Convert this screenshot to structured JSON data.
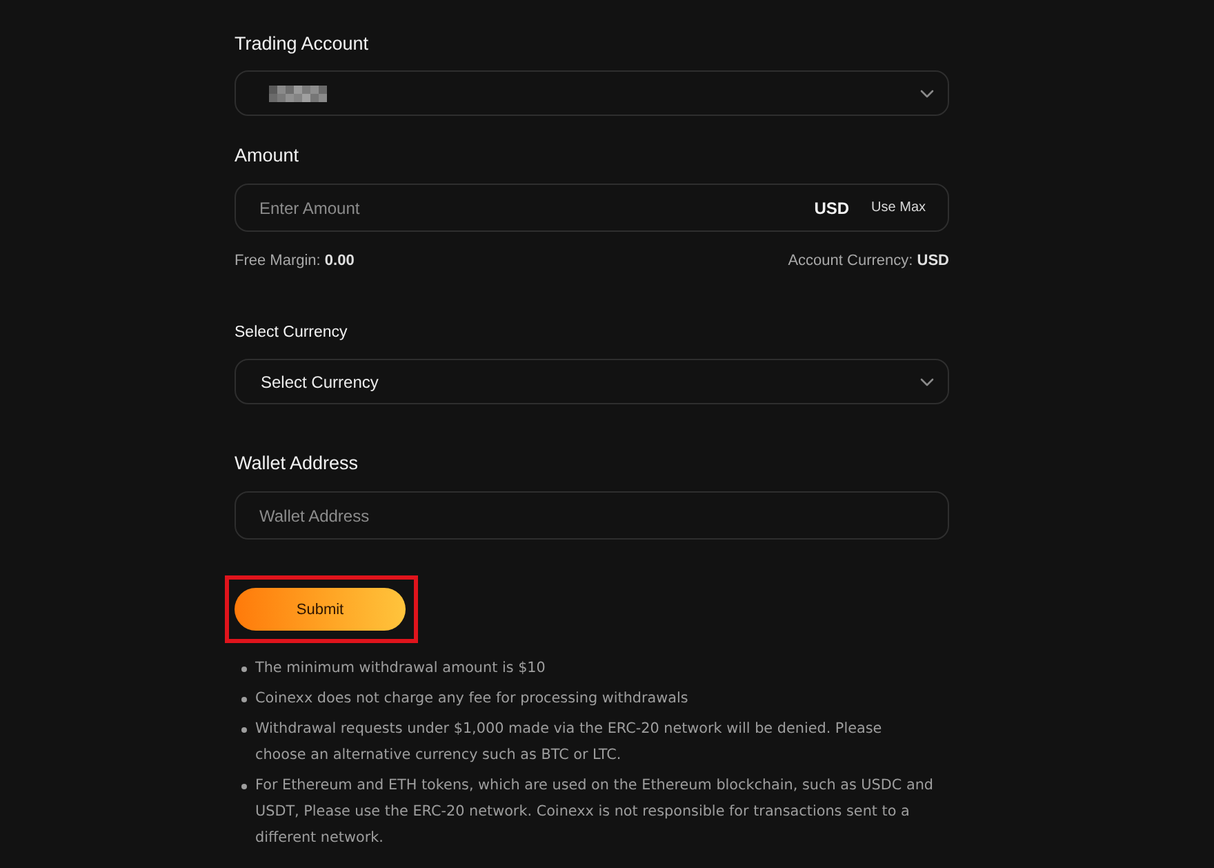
{
  "trading_account": {
    "label": "Trading Account",
    "value_hidden": true
  },
  "amount": {
    "label": "Amount",
    "placeholder": "Enter Amount",
    "currency": "USD",
    "action": "Use Max"
  },
  "margin_info": {
    "free_margin": "Free Margin: **0.00**",
    "account_currency": "Account Currency: **USD**"
  },
  "currency": {
    "label": "Select Currency",
    "value": "Select Currency"
  },
  "wallet": {
    "label": "Wallet Address",
    "placeholder": "Wallet Address"
  },
  "submit": {
    "label": "Submit",
    "highlighted": true
  },
  "notes": [
    "The minimum withdrawal amount is $10",
    "Coinexx does not charge any fee for processing withdrawals",
    "Withdrawal requests under $1,000 made via the ERC-20 network will be denied. Please choose an alternative currency such as BTC or LTC.",
    "For Ethereum and ETH tokens, which are used on the Ethereum blockchain, such as USDC and USDT, Please use the ERC-20 network. Coinexx is not responsible for transactions sent to a different network."
  ]
}
